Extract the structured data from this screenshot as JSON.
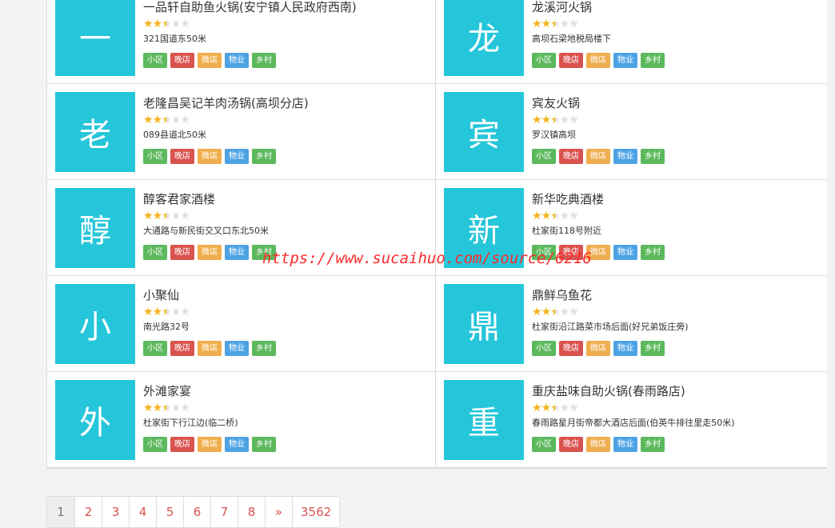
{
  "colors": {
    "avatar_bg": "#26c6da",
    "star_full": "#f6b51e",
    "star_empty": "#dddddd",
    "link": "#d9534f",
    "watermark": "#ff2a2a"
  },
  "tags": [
    {
      "label": "小区",
      "color": "#5cb85c"
    },
    {
      "label": "晚店",
      "color": "#d9534f"
    },
    {
      "label": "微店",
      "color": "#f0ad4e"
    },
    {
      "label": "物业",
      "color": "#4ea3e5"
    },
    {
      "label": "乡村",
      "color": "#5cb85c"
    }
  ],
  "restaurants": [
    {
      "initial": "一",
      "name": "一品轩自助鱼火锅(安宁镇人民政府西南)",
      "address": "321国道东50米",
      "rating": 2.5
    },
    {
      "initial": "龙",
      "name": "龙溪河火锅",
      "address": "高坝石梁地税局楼下",
      "rating": 2.5
    },
    {
      "initial": "老",
      "name": "老隆昌吴记羊肉汤锅(高坝分店)",
      "address": "089县道北50米",
      "rating": 2.5
    },
    {
      "initial": "宾",
      "name": "宾友火锅",
      "address": "罗汉镇高坝",
      "rating": 2.5
    },
    {
      "initial": "醇",
      "name": "醇客君家酒楼",
      "address": "大通路与新民街交叉口东北50米",
      "rating": 2.5
    },
    {
      "initial": "新",
      "name": "新华吃典酒楼",
      "address": "杜家街118号附近",
      "rating": 2.5
    },
    {
      "initial": "小",
      "name": "小聚仙",
      "address": "南光路32号",
      "rating": 2.5
    },
    {
      "initial": "鼎",
      "name": "鼎鲜乌鱼花",
      "address": "杜家街沿江路菜市场后面(好兄弟饭庄旁)",
      "rating": 2.5
    },
    {
      "initial": "外",
      "name": "外滩家宴",
      "address": "杜家街下行江边(临二桥)",
      "rating": 2.5
    },
    {
      "initial": "重",
      "name": "重庆盐味自助火锅(春雨路店)",
      "address": "春雨路星月街帝都大酒店后面(伯英牛排往里走50米)",
      "rating": 2.5
    }
  ],
  "watermark": "https://www.sucaihuo.com/source/6216",
  "pagination": {
    "pages": [
      "1",
      "2",
      "3",
      "4",
      "5",
      "6",
      "7",
      "8",
      "»",
      "3562"
    ],
    "current": 0
  }
}
